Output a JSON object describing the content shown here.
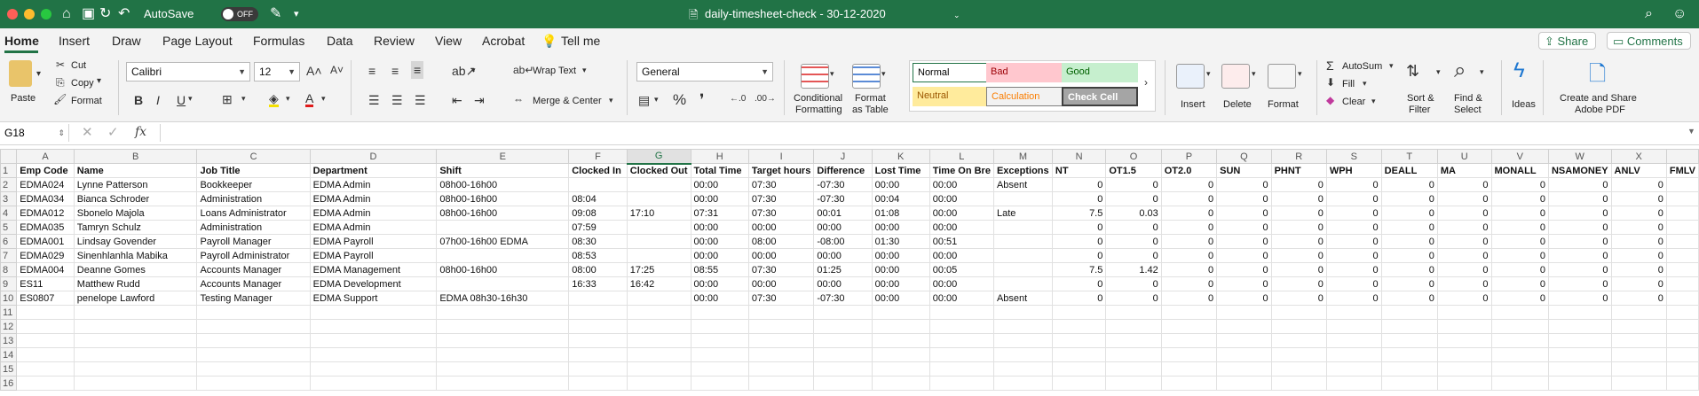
{
  "window": {
    "title": "daily-timesheet-check - 30-12-2020",
    "autosave_label": "AutoSave",
    "autosave_state": "OFF"
  },
  "tabs": [
    "Home",
    "Insert",
    "Draw",
    "Page Layout",
    "Formulas",
    "Data",
    "Review",
    "View",
    "Acrobat"
  ],
  "tell_me": "Tell me",
  "share_label": "Share",
  "comments_label": "Comments",
  "ribbon": {
    "paste": "Paste",
    "cut": "Cut",
    "copy": "Copy",
    "format_painter": "Format",
    "font_name": "Calibri",
    "font_size": "12",
    "wrap_text": "Wrap Text",
    "merge_center": "Merge & Center",
    "number_format": "General",
    "conditional_formatting_1": "Conditional",
    "conditional_formatting_2": "Formatting",
    "format_as_table_1": "Format",
    "format_as_table_2": "as Table",
    "styles": {
      "normal": "Normal",
      "bad": "Bad",
      "good": "Good",
      "neutral": "Neutral",
      "calculation": "Calculation",
      "check_cell": "Check Cell"
    },
    "insert": "Insert",
    "delete": "Delete",
    "format": "Format",
    "autosum": "AutoSum",
    "fill": "Fill",
    "clear": "Clear",
    "sort_filter_1": "Sort &",
    "sort_filter_2": "Filter",
    "find_select_1": "Find &",
    "find_select_2": "Select",
    "ideas": "Ideas",
    "create_share_1": "Create and Share",
    "create_share_2": "Adobe PDF"
  },
  "formula_bar": {
    "name_box": "G18",
    "fx": "fx",
    "formula": ""
  },
  "sheet": {
    "columns": [
      "A",
      "B",
      "C",
      "D",
      "E",
      "F",
      "G",
      "H",
      "I",
      "J",
      "K",
      "L",
      "M",
      "N",
      "O",
      "P",
      "Q",
      "R",
      "S",
      "T",
      "U",
      "V",
      "W",
      "X"
    ],
    "selected_column": "G",
    "header": [
      "Emp Code",
      "Name",
      "Job Title",
      "Department",
      "Shift",
      "Clocked In",
      "Clocked Out",
      "Total Time",
      "Target hours",
      "Difference",
      "Lost Time",
      "Time On Bre",
      "Exceptions",
      "NT",
      "OT1.5",
      "OT2.0",
      "SUN",
      "PHNT",
      "WPH",
      "DEALL",
      "MA",
      "MONALL",
      "NSAMONEY",
      "ANLV",
      "FMLV"
    ],
    "rows": [
      [
        "EDMA024",
        "Lynne Patterson",
        "Bookkeeper",
        "EDMA Admin",
        "08h00-16h00",
        "",
        "",
        "00:00",
        "07:30",
        "-07:30",
        "00:00",
        "00:00",
        "Absent",
        "0",
        "0",
        "0",
        "0",
        "0",
        "0",
        "0",
        "0",
        "0",
        "0",
        "0"
      ],
      [
        "EDMA034",
        "Bianca Schroder",
        "Administration",
        "EDMA Admin",
        "08h00-16h00",
        "08:04",
        "",
        "00:00",
        "07:30",
        "-07:30",
        "00:04",
        "00:00",
        "",
        "0",
        "0",
        "0",
        "0",
        "0",
        "0",
        "0",
        "0",
        "0",
        "0",
        "0"
      ],
      [
        "EDMA012",
        "Sbonelo Majola",
        "Loans Administrator",
        "EDMA Admin",
        "08h00-16h00",
        "09:08",
        "17:10",
        "07:31",
        "07:30",
        "00:01",
        "01:08",
        "00:00",
        "Late",
        "7.5",
        "0.03",
        "0",
        "0",
        "0",
        "0",
        "0",
        "0",
        "0",
        "0",
        "0"
      ],
      [
        "EDMA035",
        "Tamryn Schulz",
        "Administration",
        "EDMA Admin",
        "",
        "07:59",
        "",
        "00:00",
        "00:00",
        "00:00",
        "00:00",
        "00:00",
        "",
        "0",
        "0",
        "0",
        "0",
        "0",
        "0",
        "0",
        "0",
        "0",
        "0",
        "0"
      ],
      [
        "EDMA001",
        "Lindsay Govender",
        "Payroll Manager",
        "EDMA Payroll",
        "07h00-16h00 EDMA",
        "08:30",
        "",
        "00:00",
        "08:00",
        "-08:00",
        "01:30",
        "00:51",
        "",
        "0",
        "0",
        "0",
        "0",
        "0",
        "0",
        "0",
        "0",
        "0",
        "0",
        "0"
      ],
      [
        "EDMA029",
        "Sinenhlanhla Mabika",
        "Payroll Administrator",
        "EDMA Payroll",
        "",
        "08:53",
        "",
        "00:00",
        "00:00",
        "00:00",
        "00:00",
        "00:00",
        "",
        "0",
        "0",
        "0",
        "0",
        "0",
        "0",
        "0",
        "0",
        "0",
        "0",
        "0"
      ],
      [
        "EDMA004",
        "Deanne Gomes",
        "Accounts Manager",
        "EDMA Management",
        "08h00-16h00",
        "08:00",
        "17:25",
        "08:55",
        "07:30",
        "01:25",
        "00:00",
        "00:05",
        "",
        "7.5",
        "1.42",
        "0",
        "0",
        "0",
        "0",
        "0",
        "0",
        "0",
        "0",
        "0"
      ],
      [
        "ES11",
        "Matthew Rudd",
        "Accounts Manager",
        "EDMA Development",
        "",
        "16:33",
        "16:42",
        "00:00",
        "00:00",
        "00:00",
        "00:00",
        "00:00",
        "",
        "0",
        "0",
        "0",
        "0",
        "0",
        "0",
        "0",
        "0",
        "0",
        "0",
        "0"
      ],
      [
        "ES0807",
        "penelope Lawford",
        "Testing Manager",
        "EDMA Support",
        "EDMA 08h30-16h30",
        "",
        "",
        "00:00",
        "07:30",
        "-07:30",
        "00:00",
        "00:00",
        "Absent",
        "0",
        "0",
        "0",
        "0",
        "0",
        "0",
        "0",
        "0",
        "0",
        "0",
        "0"
      ]
    ],
    "empty_row_numbers": [
      "11",
      "12",
      "13",
      "14",
      "15",
      "16"
    ]
  }
}
